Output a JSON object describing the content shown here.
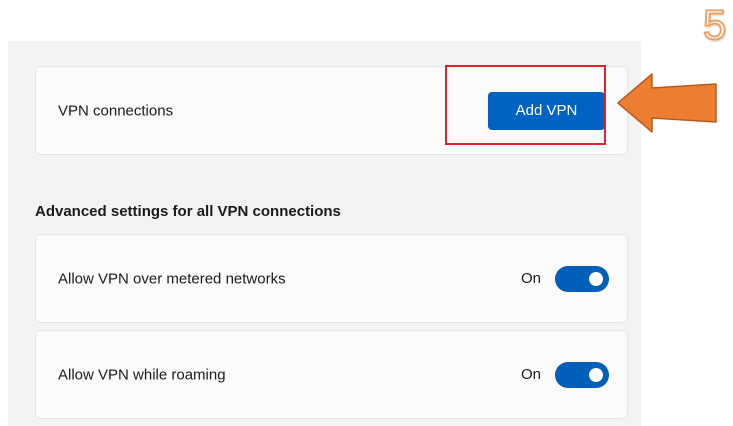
{
  "vpn": {
    "connections_label": "VPN connections",
    "add_button_label": "Add VPN"
  },
  "advanced": {
    "heading": "Advanced settings for all VPN connections",
    "settings": [
      {
        "label": "Allow VPN over metered networks",
        "state": "On",
        "enabled": true
      },
      {
        "label": "Allow VPN while roaming",
        "state": "On",
        "enabled": true
      }
    ]
  },
  "annotation": {
    "step_number": "5",
    "arrow_color": "#ed7d31",
    "highlight_color": "#e3202a"
  },
  "colors": {
    "accent": "#0063c1",
    "toggle_on": "#005fb8",
    "panel_background": "#f3f3f3",
    "card_background": "#fbfbfb"
  }
}
